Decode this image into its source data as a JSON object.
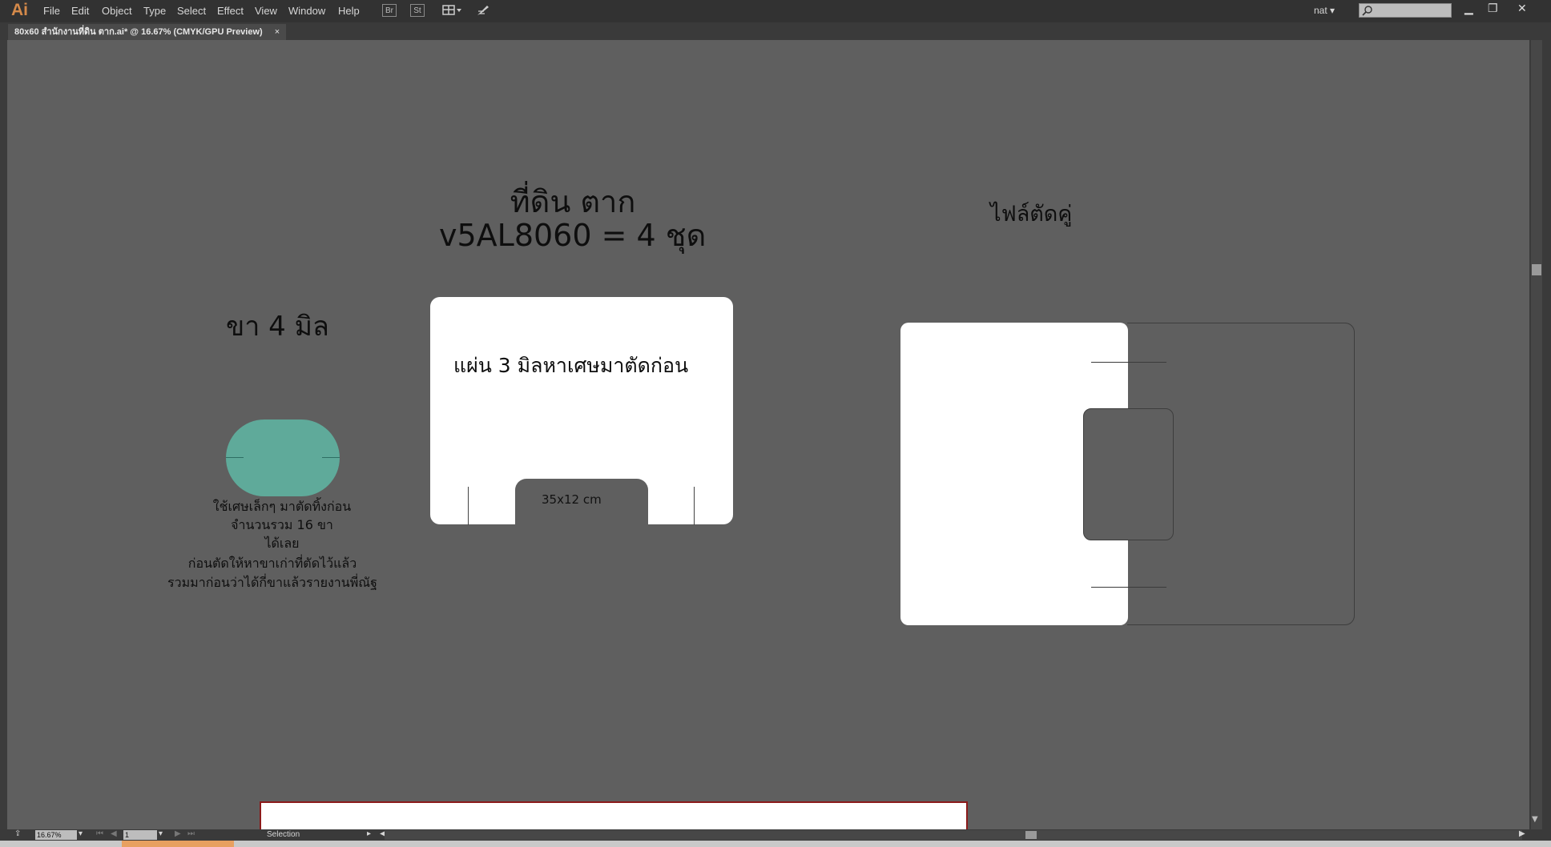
{
  "app": {
    "logo": "Ai"
  },
  "menu": [
    "File",
    "Edit",
    "Object",
    "Type",
    "Select",
    "Effect",
    "View",
    "Window",
    "Help"
  ],
  "toolbar": {
    "bridge_label": "Br",
    "stock_label": "St"
  },
  "user": {
    "name": "nat ▾"
  },
  "document": {
    "tab_title": "80x60 สำนักงานที่ดิน ตาก.ai* @ 16.67% (CMYK/GPU Preview)",
    "close": "×"
  },
  "artwork": {
    "title_line1": "ที่ดิน ตาก",
    "title_line2": "v5AL8060 = 4 ชุด",
    "board_note": "แผ่น 3 มิลหาเศษมาตัดก่อน",
    "notch_size": "35x12 cm",
    "leg_title": "ขา 4 มิล",
    "leg_note_1": "ใช้เศษเล็กๆ มาตัดทิ้งก่อน",
    "leg_note_2": "จำนวนรวม 16 ขา",
    "leg_note_3": "ได้เลย",
    "leg_note_4": "ก่อนตัดให้หาขาเก่าที่ตัดไว้แล้ว",
    "leg_note_5": "รวมมาก่อนว่าได้กี่ขาแล้วรายงานพี่ณัฐ",
    "right_title": "ไฟล์ตัดคู่",
    "leg_color": "#5faa9a"
  },
  "status": {
    "zoom": "16.67%",
    "page": "1",
    "tool": "Selection"
  }
}
